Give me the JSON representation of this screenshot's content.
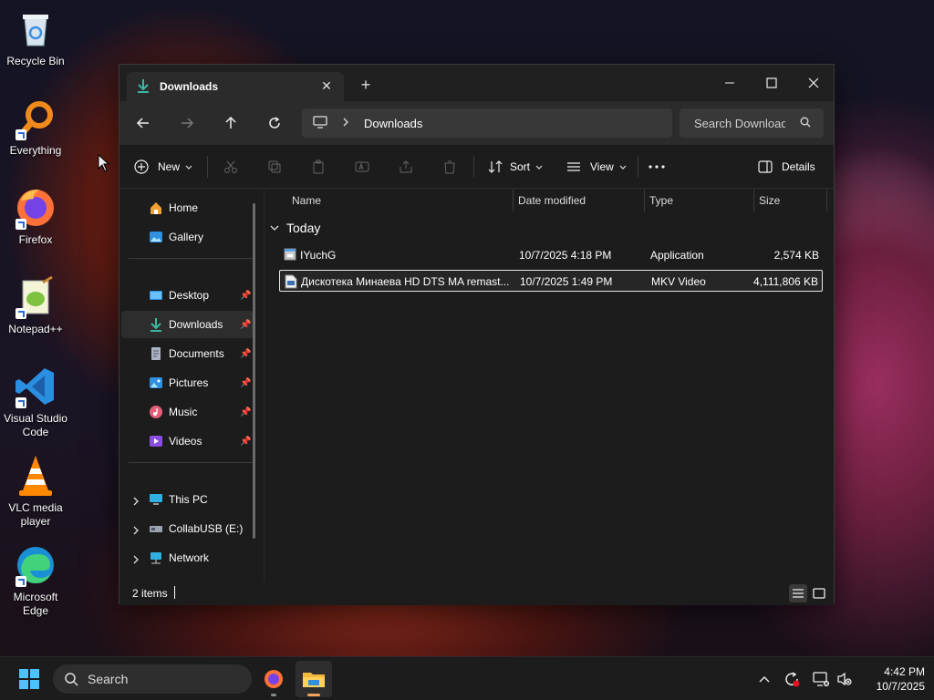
{
  "desktop": {
    "icons": [
      {
        "label": "Recycle Bin",
        "icon": "recycle-bin-icon"
      },
      {
        "label": "Everything",
        "icon": "everything-search-icon"
      },
      {
        "label": "Firefox",
        "icon": "firefox-icon"
      },
      {
        "label": "Notepad++",
        "icon": "notepad-plus-plus-icon"
      },
      {
        "label": "Visual Studio Code",
        "icon": "vscode-icon"
      },
      {
        "label": "VLC media player",
        "icon": "vlc-icon"
      },
      {
        "label": "Microsoft Edge",
        "icon": "edge-icon"
      }
    ]
  },
  "window": {
    "tab_title": "Downloads",
    "address": {
      "crumb": "Downloads"
    },
    "search": {
      "placeholder": "Search Downloads"
    },
    "commands": {
      "new_label": "New",
      "sort_label": "Sort",
      "view_label": "View",
      "details_label": "Details"
    },
    "sidebar": {
      "items": [
        {
          "label": "Home",
          "icon": "home-icon"
        },
        {
          "label": "Gallery",
          "icon": "gallery-icon"
        },
        {
          "label": "Desktop",
          "icon": "desktop-folder-icon",
          "pinned": true
        },
        {
          "label": "Downloads",
          "icon": "downloads-folder-icon",
          "pinned": true,
          "active": true
        },
        {
          "label": "Documents",
          "icon": "documents-folder-icon",
          "pinned": true
        },
        {
          "label": "Pictures",
          "icon": "pictures-folder-icon",
          "pinned": true
        },
        {
          "label": "Music",
          "icon": "music-folder-icon",
          "pinned": true
        },
        {
          "label": "Videos",
          "icon": "videos-folder-icon",
          "pinned": true
        },
        {
          "label": "This PC",
          "icon": "this-pc-icon",
          "expandable": true
        },
        {
          "label": "CollabUSB (E:)",
          "icon": "usb-drive-icon",
          "expandable": true
        },
        {
          "label": "Network",
          "icon": "network-icon",
          "expandable": true
        }
      ]
    },
    "columns": {
      "name": "Name",
      "date": "Date modified",
      "type": "Type",
      "size": "Size"
    },
    "group": "Today",
    "files": [
      {
        "name": "IYuchG",
        "date": "10/7/2025 4:18 PM",
        "type": "Application",
        "size": "2,574 KB",
        "icon": "application-icon",
        "selected": false
      },
      {
        "name": "Дискотека Минаева HD DTS MA remast...",
        "date": "10/7/2025 1:49 PM",
        "type": "MKV Video",
        "size": "4,111,806 KB",
        "icon": "video-file-icon",
        "selected": true
      }
    ],
    "status": {
      "items_count": "2 items"
    }
  },
  "taskbar": {
    "search_placeholder": "Search",
    "clock": {
      "time": "4:42 PM",
      "date": "10/7/2025"
    }
  },
  "colors": {
    "accent": "#3db8a0",
    "selection_border": "#e6e6e6",
    "window_bg": "#1c1c1c"
  }
}
